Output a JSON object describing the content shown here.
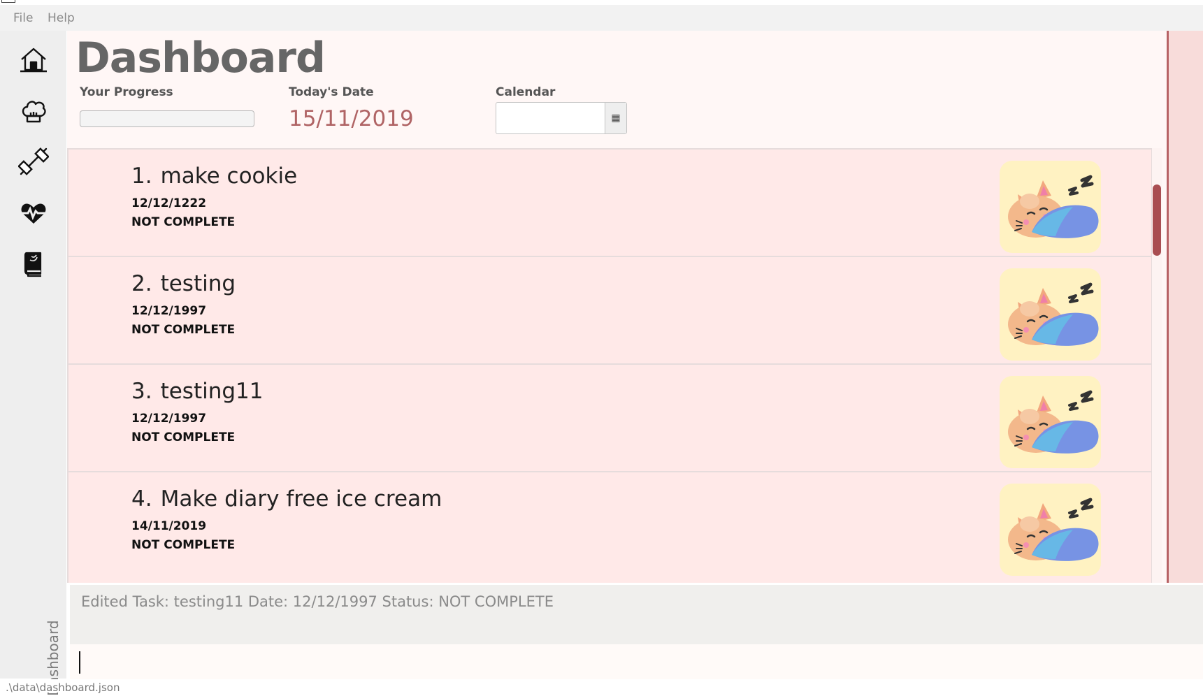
{
  "menu": {
    "file": "File",
    "help": "Help"
  },
  "sidebar": {
    "items": [
      {
        "icon": "home-icon"
      },
      {
        "icon": "chef-hat-icon"
      },
      {
        "icon": "dumbbell-icon"
      },
      {
        "icon": "heart-pulse-icon"
      },
      {
        "icon": "book-icon"
      }
    ],
    "page_label": "Dashboard"
  },
  "header": {
    "title": "Dashboard",
    "progress_label": "Your Progress",
    "progress_value": 0,
    "date_label": "Today's Date",
    "date_value": "15/11/2019",
    "calendar_label": "Calendar",
    "calendar_value": "",
    "calendar_button_icon": "calendar-icon"
  },
  "tasks": [
    {
      "number": "1.",
      "name": "make cookie",
      "date": "12/12/1222",
      "status": "NOT COMPLETE",
      "image": "sleeping-cat-icon"
    },
    {
      "number": "2.",
      "name": "testing",
      "date": "12/12/1997",
      "status": "NOT COMPLETE",
      "image": "sleeping-cat-icon"
    },
    {
      "number": "3.",
      "name": "testing11",
      "date": "12/12/1997",
      "status": "NOT COMPLETE",
      "image": "sleeping-cat-icon"
    },
    {
      "number": "4.",
      "name": "Make diary free ice cream",
      "date": "14/11/2019",
      "status": "NOT COMPLETE",
      "image": "sleeping-cat-icon"
    }
  ],
  "feedback": "Edited Task: testing11 Date: 12/12/1997 Status: NOT COMPLETE",
  "command": {
    "value": ""
  },
  "status_bar": ".\\data\\dashboard.json",
  "colors": {
    "accent": "#b06465",
    "card_background": "#ffe9e8",
    "scroll_thumb": "#a94e52",
    "cat_tile": "#fff2c2"
  }
}
